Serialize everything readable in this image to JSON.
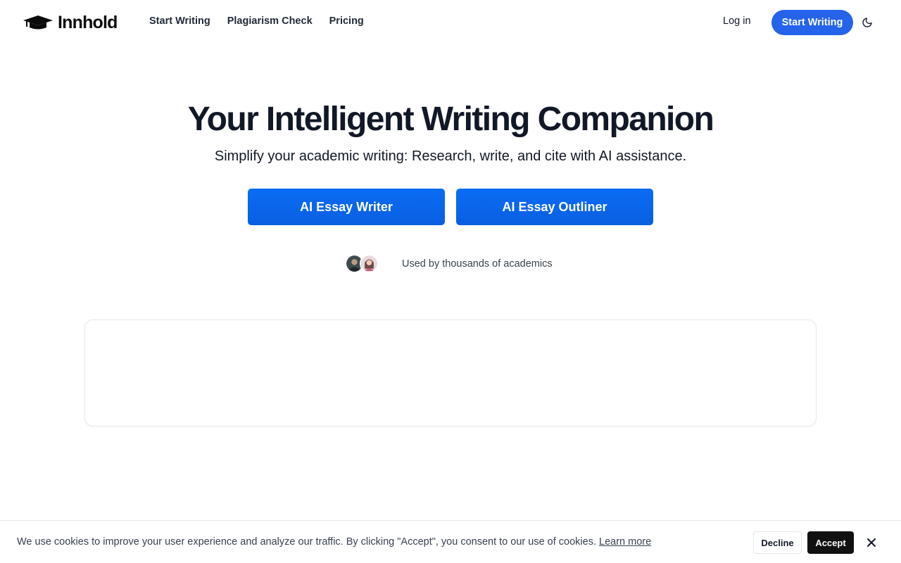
{
  "header": {
    "brand": "Innhold",
    "logo_icon": "graduation-cap-icon",
    "nav": [
      "Start Writing",
      "Plagiarism Check",
      "Pricing"
    ],
    "login_label": "Log in",
    "cta_label": "Start Writing",
    "theme_icon": "moon-icon"
  },
  "hero": {
    "title": "Your Intelligent Writing Companion",
    "subtitle": "Simplify your academic writing: Research, write, and cite with AI assistance.",
    "primary_button": "AI Essay Writer",
    "secondary_button": "AI Essay Outliner",
    "social_proof": "Used by thousands of academics"
  },
  "cookie": {
    "message": "We use cookies to improve your user experience and analyze our traffic. By clicking \"Accept\", you consent to our use of cookies.",
    "learn_more": "Learn more",
    "decline_label": "Decline",
    "accept_label": "Accept",
    "close_icon": "close-icon"
  },
  "colors": {
    "accent": "#2563eb",
    "button": "#0b6cf5",
    "accept_bg": "#111111"
  }
}
